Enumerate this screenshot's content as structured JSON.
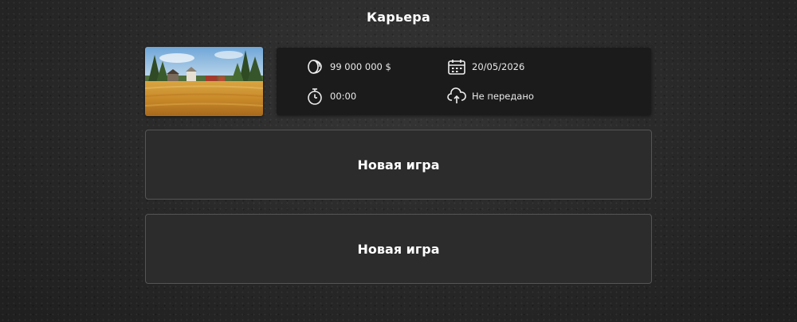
{
  "header": {
    "title": "Карьера"
  },
  "savegame": {
    "money": "99 000 000 $",
    "date": "20/05/2026",
    "playtime": "00:00",
    "upload_status": "Не передано",
    "icons": {
      "money": "coin-icon",
      "date": "calendar-icon",
      "playtime": "stopwatch-icon",
      "upload": "cloud-upload-icon"
    }
  },
  "slots": [
    {
      "label": "Новая игра"
    },
    {
      "label": "Новая игра"
    }
  ],
  "colors": {
    "background": "#2a2a2a",
    "panel": "#1b1b1b",
    "slot": "#2c2c2c",
    "slot_border": "#555555"
  }
}
